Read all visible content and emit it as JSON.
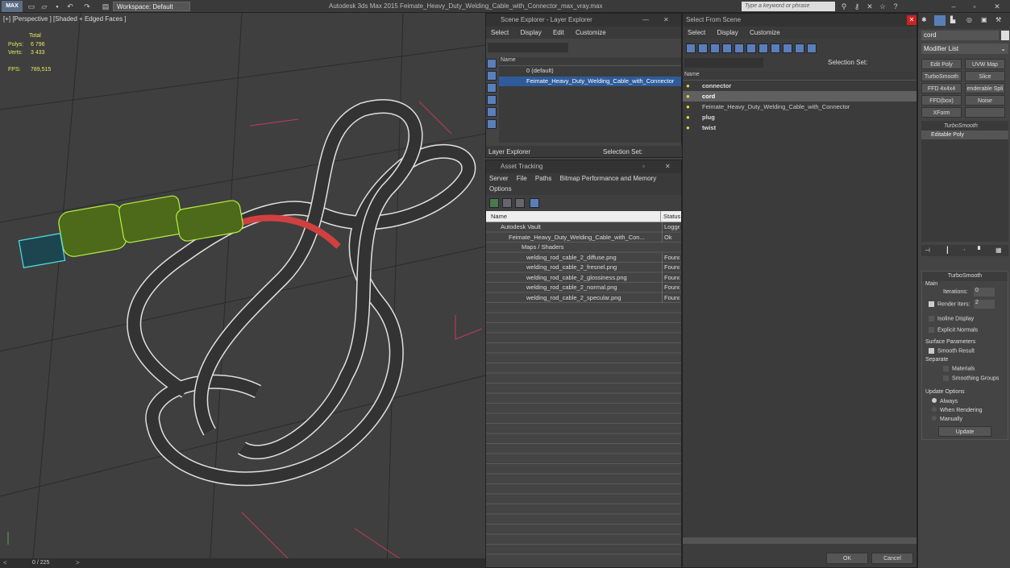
{
  "app": {
    "logo_text": "MAX",
    "workspace": "Workspace: Default",
    "title": "Autodesk 3ds Max  2015     Feimate_Heavy_Duty_Welding_Cable_with_Connector_max_vray.max",
    "search_placeholder": "Type a keyword or phrase"
  },
  "viewport": {
    "label": "[+] [Perspective ] [Shaded + Edged Faces ]",
    "stats_header": "Total",
    "polys_label": "Polys:",
    "polys_value": "6 796",
    "verts_label": "Verts:",
    "verts_value": "3 433",
    "fps_label": "FPS:",
    "fps_value": "789,515",
    "time_slider": "0 / 225"
  },
  "scene_explorer": {
    "title": "Scene Explorer - Layer Explorer",
    "menu": [
      "Select",
      "Display",
      "Edit",
      "Customize"
    ],
    "column_name": "Name",
    "rows": [
      "0 (default)",
      "Feimate_Heavy_Duty_Welding_Cable_with_Connector"
    ],
    "footer_dropdown": "Layer Explorer",
    "footer_selection": "Selection Set:"
  },
  "asset_tracking": {
    "title": "Asset Tracking",
    "menu": [
      "Server",
      "File",
      "Paths",
      "Bitmap Performance and Memory"
    ],
    "menu2": "Options",
    "col_name": "Name",
    "col_status": "Status",
    "rows": [
      {
        "name": "Autodesk Vault",
        "status": "Logged"
      },
      {
        "name": "Feimate_Heavy_Duty_Welding_Cable_with_Con...",
        "status": "Ok"
      },
      {
        "name": "Maps / Shaders",
        "status": ""
      },
      {
        "name": "welding_rod_cable_2_diffuse.png",
        "status": "Found"
      },
      {
        "name": "welding_rod_cable_2_fresnel.png",
        "status": "Found"
      },
      {
        "name": "welding_rod_cable_2_glossiness.png",
        "status": "Found"
      },
      {
        "name": "welding_rod_cable_2_normal.png",
        "status": "Found"
      },
      {
        "name": "welding_rod_cable_2_specular.png",
        "status": "Found"
      }
    ]
  },
  "select_from_scene": {
    "title": "Select From Scene",
    "menu": [
      "Select",
      "Display",
      "Customize"
    ],
    "selection_set": "Selection Set:",
    "column_name": "Name",
    "rows": [
      "connector",
      "cord",
      "Feimate_Heavy_Duty_Welding_Cable_with_Connector",
      "plug",
      "twist"
    ],
    "ok": "OK",
    "cancel": "Cancel"
  },
  "modifier_panel": {
    "object_name": "cord",
    "modifier_list": "Modifier List",
    "buttons": [
      "Edit Poly",
      "UVW Map",
      "TurboSmooth",
      "Slice",
      "FFD 4x4x4",
      "enderable Spli",
      "FFD(box)",
      "Noise",
      "XForm",
      ""
    ],
    "stack": [
      "TurboSmooth",
      "Editable Poly"
    ],
    "rollout_title": "TurboSmooth",
    "main": "Main",
    "iterations_label": "Iterations:",
    "iterations_value": "0",
    "render_iters_label": "Render Iters:",
    "render_iters_value": "2",
    "isoline": "Isoline Display",
    "explicit": "Explicit Normals",
    "surface_params": "Surface Parameters",
    "smooth_result": "Smooth Result",
    "separate": "Separate",
    "materials": "Materials",
    "smoothing_groups": "Smoothing Groups",
    "update_options": "Update Options",
    "always": "Always",
    "when_rendering": "When Rendering",
    "manually": "Manually",
    "update": "Update"
  }
}
